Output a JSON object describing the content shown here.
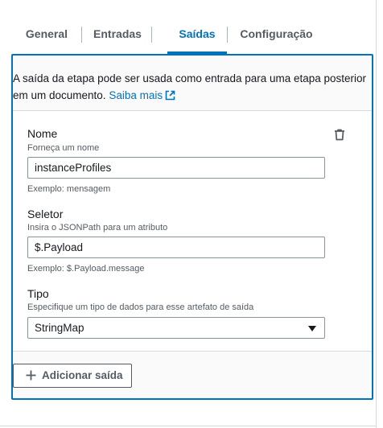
{
  "tabs": [
    {
      "label": "General"
    },
    {
      "label": "Entradas"
    },
    {
      "label": "Saídas"
    },
    {
      "label": "Configuração"
    }
  ],
  "active_tab": "Saídas",
  "description": {
    "text": "A saída da etapa pode ser usada como entrada para uma etapa posterior em um documento.",
    "link_label": "Saiba mais"
  },
  "output": {
    "name": {
      "label": "Nome",
      "hint": "Forneça um nome",
      "value": "instanceProfiles",
      "example": "Exemplo: mensagem"
    },
    "selector": {
      "label": "Seletor",
      "hint": "Insira o JSONPath para um atributo",
      "value": "$.Payload",
      "example": "Exemplo: $.Payload.message"
    },
    "type": {
      "label": "Tipo",
      "hint": "Especifique um tipo de dados para esse artefato de saída",
      "value": "StringMap"
    }
  },
  "add_button_label": "Adicionar saída",
  "colors": {
    "accent": "#0073bb",
    "text": "#16191f",
    "muted": "#545b64",
    "border": "#879596"
  },
  "icons": [
    "external-link-icon",
    "trash-icon",
    "chevron-down-icon",
    "plus-icon"
  ]
}
